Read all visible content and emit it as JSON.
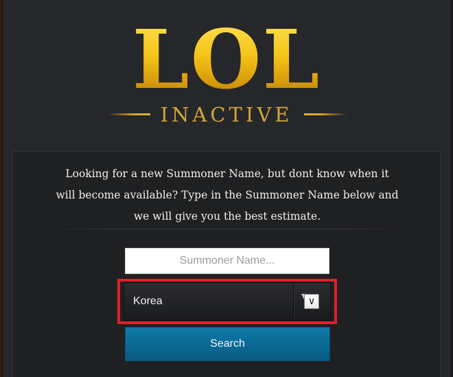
{
  "logo": {
    "title": "LOL",
    "subtitle": "INACTIVE"
  },
  "intro": {
    "text": "Looking for a new Summoner Name, but dont know when it will become available? Type in the Summoner Name below and we will give you the best estimate."
  },
  "search": {
    "placeholder": "Summoner Name...",
    "value": ""
  },
  "region": {
    "selected": "Korea",
    "arrow_icon": "chevron-down-icon"
  },
  "button": {
    "search_label": "Search"
  },
  "colors": {
    "background": "#26272a",
    "panel": "#1f2022",
    "gold": "#d2a637",
    "highlight": "#e0202a",
    "button": "#0a6a95"
  }
}
